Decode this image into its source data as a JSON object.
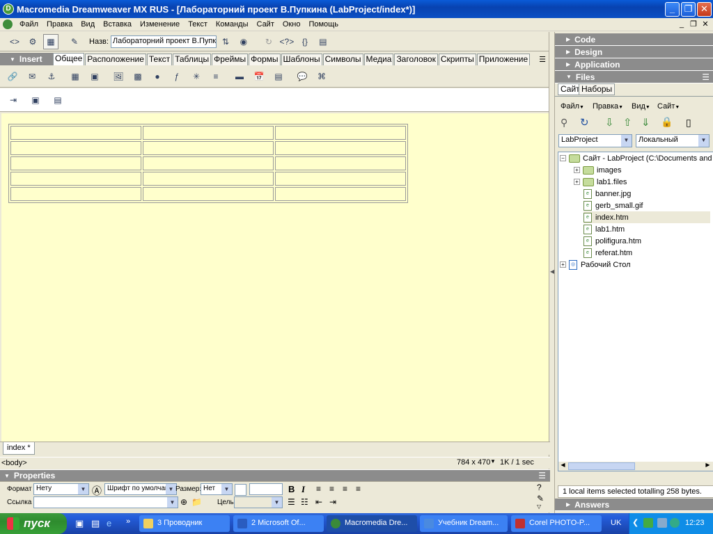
{
  "window": {
    "title": "Macromedia Dreamweaver MX RUS - [Лабораторний проект В.Пупкина (LabProject/index*)]"
  },
  "menu": [
    "Файл",
    "Правка",
    "Вид",
    "Вставка",
    "Изменение",
    "Текст",
    "Команды",
    "Сайт",
    "Окно",
    "Помощь"
  ],
  "doc_toolbar": {
    "title_label": "Назв:",
    "title_value": "Лабораторний проект В.Пупк"
  },
  "insert": {
    "label": "Insert",
    "tabs": [
      "Общее",
      "Расположение",
      "Текст",
      "Таблицы",
      "Фреймы",
      "Формы",
      "Шаблоны",
      "Символы",
      "Медиа",
      "Заголовок",
      "Скрипты",
      "Приложение"
    ],
    "active_tab": "Общее"
  },
  "design": {
    "table_rows": 5,
    "table_cols": 3
  },
  "doc_tab": "index *",
  "status": {
    "tag": "<body>",
    "size": "784 x 470",
    "weight": "1K / 1 sec"
  },
  "properties": {
    "header": "Properties",
    "format_label": "Формат",
    "format_value": "Нету",
    "font_value": "Шрифт по умолчан",
    "size_label": "Размер:",
    "size_value": "Нет",
    "link_label": "Ссылка",
    "target_label": "Цель"
  },
  "panels": {
    "code": "Code",
    "design": "Design",
    "application": "Application",
    "files": "Files",
    "answers": "Answers"
  },
  "files": {
    "tabs": [
      "Сайт",
      "Наборы"
    ],
    "menu": [
      "Файл",
      "Правка",
      "Вид",
      "Сайт"
    ],
    "site_select": "LabProject",
    "view_select": "Локальный",
    "root": "Сайт - LabProject (C:\\Documents and",
    "items": [
      {
        "name": "images",
        "type": "folder"
      },
      {
        "name": "lab1.files",
        "type": "folder"
      },
      {
        "name": "banner.jpg",
        "type": "file"
      },
      {
        "name": "gerb_small.gif",
        "type": "file"
      },
      {
        "name": "index.htm",
        "type": "file"
      },
      {
        "name": "lab1.htm",
        "type": "file"
      },
      {
        "name": "polifigura.htm",
        "type": "file"
      },
      {
        "name": "referat.htm",
        "type": "file"
      }
    ],
    "desktop": "Рабочий Стол",
    "status": "1 local items selected totalling 258 bytes."
  },
  "taskbar": {
    "start": "пуск",
    "tasks": [
      "3 Проводник",
      "2 Microsoft Of...",
      "Macromedia Dre...",
      "Учебник Dream...",
      "Corel PHOTO-P..."
    ],
    "lang": "UK",
    "clock": "12:23"
  }
}
